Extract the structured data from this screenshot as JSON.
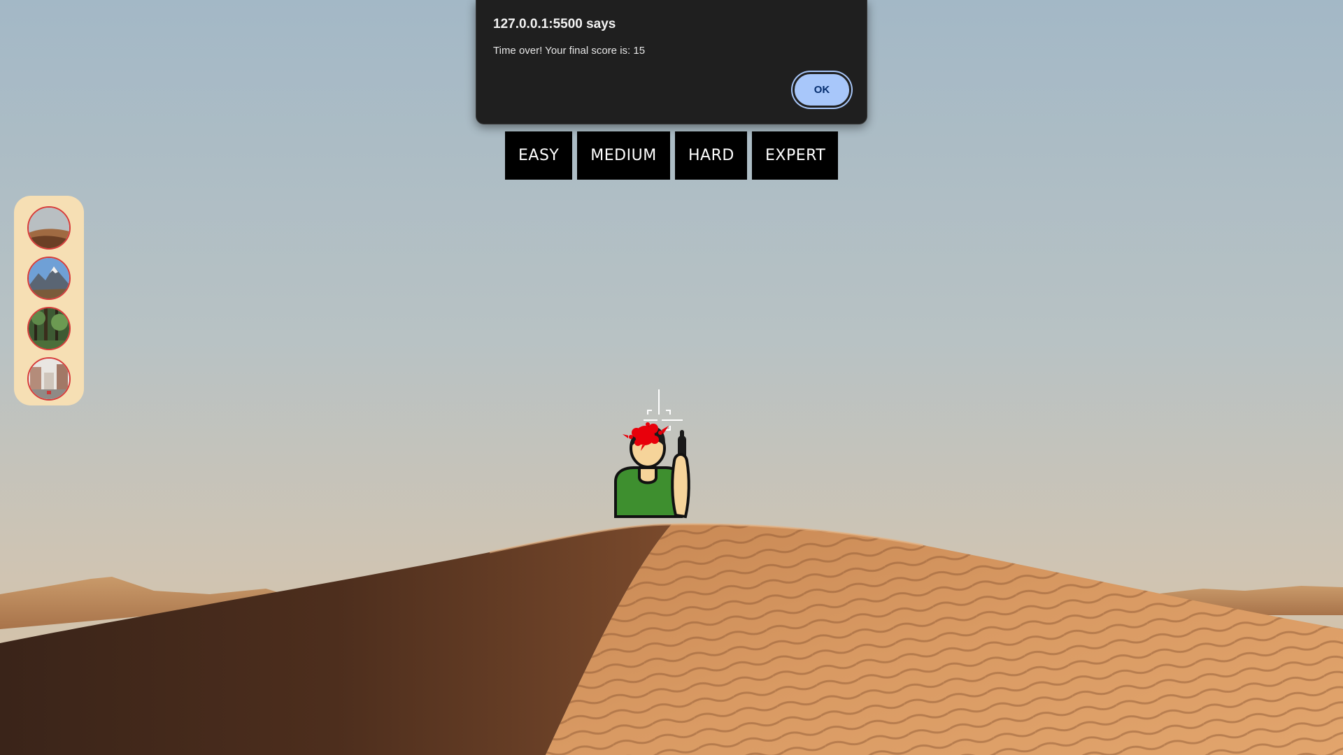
{
  "alert": {
    "origin_title": "127.0.0.1:5500 says",
    "message": "Time over! Your final score is: 15",
    "ok_label": "OK"
  },
  "levels": {
    "easy": "EASY",
    "medium": "MEDIUM",
    "hard": "HARD",
    "expert": "EXPERT"
  },
  "maps": [
    {
      "name": "desert",
      "icon": "desert-dune-icon"
    },
    {
      "name": "mountains",
      "icon": "mountains-icon"
    },
    {
      "name": "forest",
      "icon": "forest-icon"
    },
    {
      "name": "city",
      "icon": "city-street-icon"
    }
  ],
  "game": {
    "current_map": "desert",
    "target": "soldier-character",
    "hit": true,
    "score": 15
  },
  "colors": {
    "level_button_bg": "#000000",
    "level_button_text": "#ffffff",
    "map_panel_bg": "#f6dfb4",
    "map_thumb_border": "#d63a3a",
    "alert_bg": "#1f1f1f",
    "ok_button_bg": "#a8c7fa",
    "blood": "#e8000b",
    "soldier_shirt": "#3e8f2f"
  }
}
